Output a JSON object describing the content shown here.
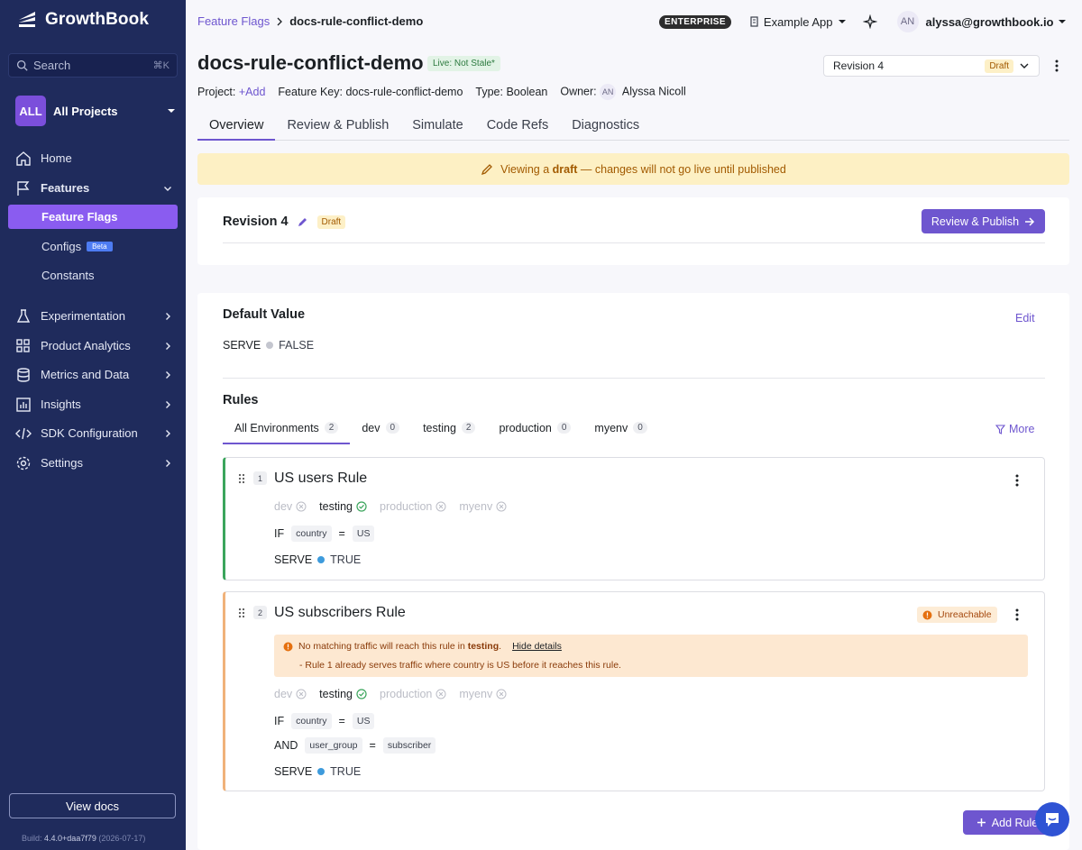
{
  "sidebar": {
    "brand": "GrowthBook",
    "search_label": "Search",
    "search_shortcut": "⌘K",
    "project_badge": "ALL",
    "project_name": "All Projects",
    "nav": [
      {
        "label": "Home",
        "icon": "home-icon"
      },
      {
        "label": "Features",
        "icon": "flag-icon"
      },
      {
        "label": "Experimentation",
        "icon": "flask-icon"
      },
      {
        "label": "Product Analytics",
        "icon": "grid-icon"
      },
      {
        "label": "Metrics and Data",
        "icon": "database-icon"
      },
      {
        "label": "Insights",
        "icon": "chart-icon"
      },
      {
        "label": "SDK Configuration",
        "icon": "code-icon"
      },
      {
        "label": "Settings",
        "icon": "gear-icon"
      }
    ],
    "features_sub": [
      {
        "label": "Feature Flags"
      },
      {
        "label": "Configs",
        "badge": "Beta"
      },
      {
        "label": "Constants"
      }
    ],
    "view_docs": "View docs",
    "build_label": "Build:",
    "build_version": "4.4.0+daa7f79",
    "build_date": "(2026-07-17)"
  },
  "topbar": {
    "breadcrumb_parent": "Feature Flags",
    "breadcrumb_current": "docs-rule-conflict-demo",
    "enterprise_badge": "ENTERPRISE",
    "org_name": "Example App",
    "user_initials": "AN",
    "user_email": "alyssa@growthbook.io"
  },
  "header": {
    "title": "docs-rule-conflict-demo",
    "stale_badge": "Live: Not Stale*",
    "revision_select": "Revision 4",
    "revision_status": "Draft",
    "project_key": "Project:",
    "project_value": "+Add",
    "feature_key_label": "Feature Key:",
    "feature_key_value": "docs-rule-conflict-demo",
    "type_label": "Type:",
    "type_value": "Boolean",
    "owner_label": "Owner:",
    "owner_initials": "AN",
    "owner_name": "Alyssa Nicoll"
  },
  "tabs": [
    "Overview",
    "Review & Publish",
    "Simulate",
    "Code Refs",
    "Diagnostics"
  ],
  "banner": {
    "prefix": "Viewing a",
    "emph": "draft",
    "suffix": "— changes will not go live until published"
  },
  "revision_card": {
    "title": "Revision 4",
    "status": "Draft",
    "publish_button": "Review & Publish"
  },
  "default_value": {
    "title": "Default Value",
    "edit": "Edit",
    "serve_label": "SERVE",
    "value": "FALSE"
  },
  "rules": {
    "title": "Rules",
    "env_tabs": [
      {
        "label": "All Environments",
        "count": "2"
      },
      {
        "label": "dev",
        "count": "0"
      },
      {
        "label": "testing",
        "count": "2"
      },
      {
        "label": "production",
        "count": "0"
      },
      {
        "label": "myenv",
        "count": "0"
      }
    ],
    "more": "More",
    "add_rule": "Add Rule",
    "items": [
      {
        "number": "1",
        "title": "US users Rule",
        "envs": [
          "dev",
          "testing",
          "production",
          "myenv"
        ],
        "if_label": "IF",
        "cond_attr": "country",
        "cond_op": "=",
        "cond_val": "US",
        "serve_label": "SERVE",
        "serve_value": "TRUE"
      },
      {
        "number": "2",
        "title": "US subscribers Rule",
        "badge": "Unreachable",
        "warning_prefix": "No matching traffic will reach this rule in",
        "warning_env": "testing",
        "warning_link": "Hide details",
        "warning_detail": "- Rule 1 already serves traffic where country is US before it reaches this rule.",
        "envs": [
          "dev",
          "testing",
          "production",
          "myenv"
        ],
        "if_label": "IF",
        "cond_attr": "country",
        "cond_op": "=",
        "cond_val": "US",
        "and_label": "AND",
        "cond2_attr": "user_group",
        "cond2_op": "=",
        "cond2_val": "subscriber",
        "serve_label": "SERVE",
        "serve_value": "TRUE"
      }
    ]
  },
  "colors": {
    "sidebar_bg": "#1f2b5c",
    "accent": "#6e56cf",
    "active_nav": "#8a5cf0",
    "draft_bg": "#fdf0c4",
    "rule1_border": "#3ba55c",
    "rule2_border": "#f0b27a"
  }
}
